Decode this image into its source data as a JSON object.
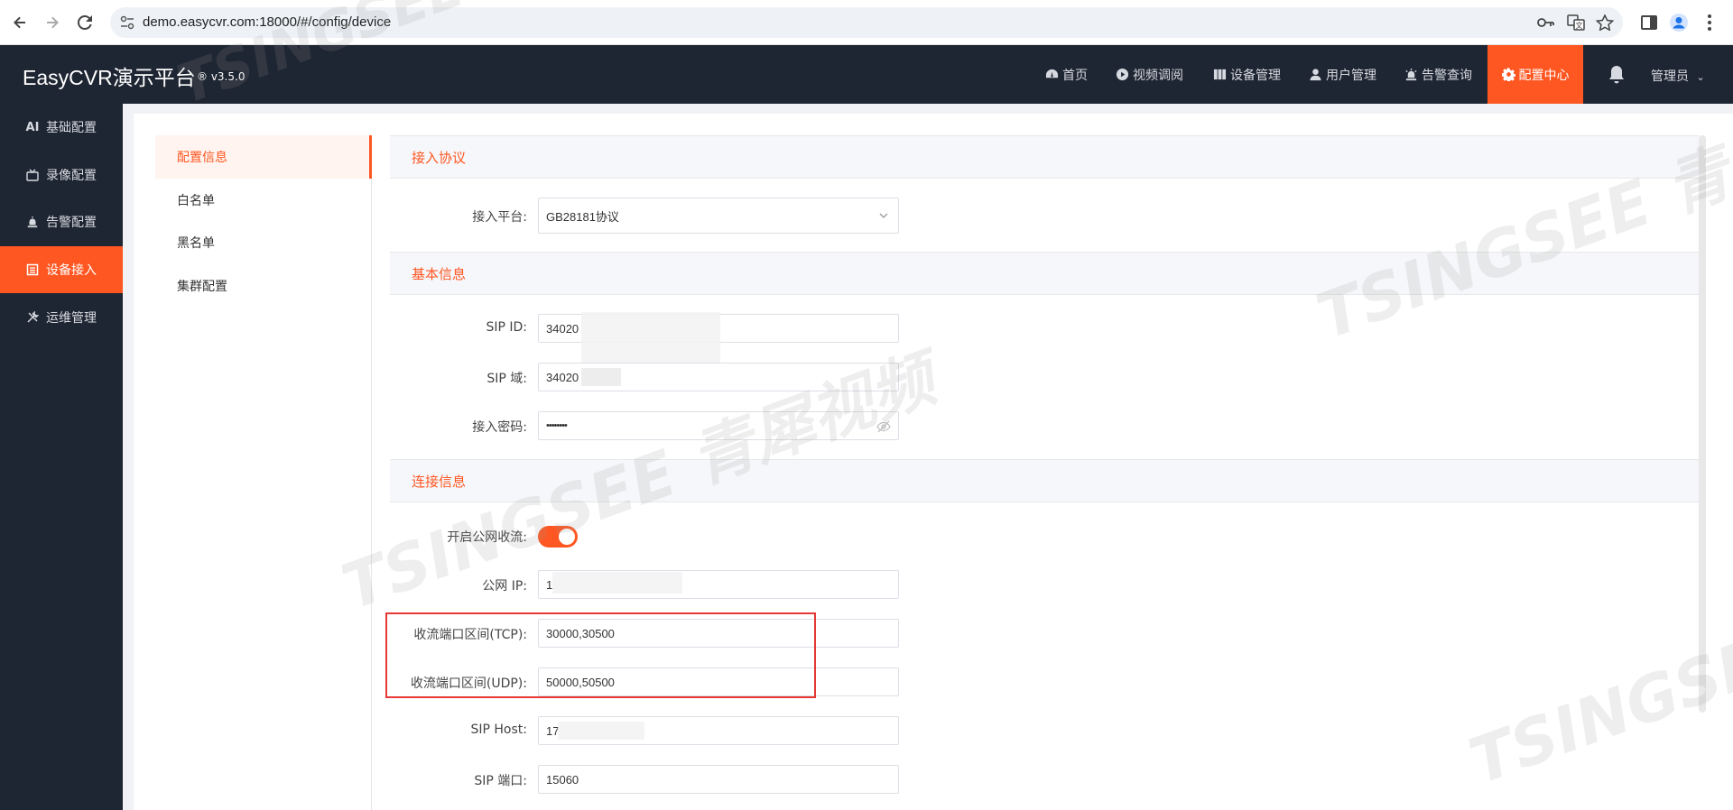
{
  "browser": {
    "url": "demo.easycvr.com:18000/#/config/device"
  },
  "header": {
    "brand": "EasyCVR演示平台",
    "version": "® v3.5.0",
    "nav": [
      {
        "label": "首页",
        "icon": "dashboard-icon"
      },
      {
        "label": "视频调阅",
        "icon": "play-icon"
      },
      {
        "label": "设备管理",
        "icon": "device-icon"
      },
      {
        "label": "用户管理",
        "icon": "user-icon"
      },
      {
        "label": "告警查询",
        "icon": "alarm-icon"
      },
      {
        "label": "配置中心",
        "icon": "gear-icon",
        "active": true
      }
    ],
    "user": "管理员",
    "accent_color": "#ff5722"
  },
  "sidebar": {
    "items": [
      {
        "label": "基础配置",
        "icon": "ai-icon"
      },
      {
        "label": "录像配置",
        "icon": "record-icon"
      },
      {
        "label": "告警配置",
        "icon": "alarm-icon"
      },
      {
        "label": "设备接入",
        "icon": "list-icon",
        "active": true
      },
      {
        "label": "运维管理",
        "icon": "tools-icon"
      }
    ]
  },
  "subnav": {
    "items": [
      {
        "label": "配置信息",
        "active": true
      },
      {
        "label": "白名单"
      },
      {
        "label": "黑名单"
      },
      {
        "label": "集群配置"
      }
    ]
  },
  "form": {
    "sections": {
      "protocol": "接入协议",
      "basic": "基本信息",
      "connection": "连接信息"
    },
    "platform": {
      "label": "接入平台:",
      "value": "GB28181协议"
    },
    "sip_id": {
      "label": "SIP ID:",
      "value": "34020"
    },
    "sip_domain": {
      "label": "SIP 域:",
      "value": "34020"
    },
    "password": {
      "label": "接入密码:",
      "value": "••••••••"
    },
    "public_stream": {
      "label": "开启公网收流:",
      "enabled": true
    },
    "public_ip": {
      "label": "公网 IP:",
      "value": "1"
    },
    "tcp_range": {
      "label": "收流端口区间(TCP):",
      "value": "30000,30500"
    },
    "udp_range": {
      "label": "收流端口区间(UDP):",
      "value": "50000,50500"
    },
    "sip_host": {
      "label": "SIP Host:",
      "value": "17"
    },
    "sip_port": {
      "label": "SIP 端口:",
      "value": "15060"
    }
  },
  "watermark": {
    "text_en": "TSINGSEE",
    "text_cn": "青犀视频"
  }
}
